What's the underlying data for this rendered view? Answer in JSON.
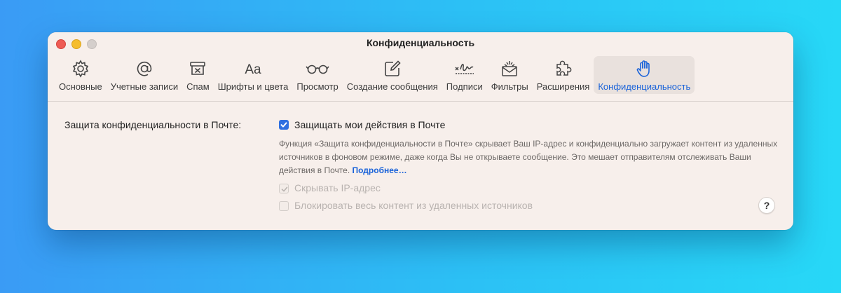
{
  "window": {
    "title": "Конфиденциальность"
  },
  "toolbar": {
    "items": [
      {
        "label": "Основные",
        "icon": "gear-icon"
      },
      {
        "label": "Учетные записи",
        "icon": "at-sign-icon"
      },
      {
        "label": "Спам",
        "icon": "junk-box-icon"
      },
      {
        "label": "Шрифты и цвета",
        "icon": "fonts-aa-icon"
      },
      {
        "label": "Просмотр",
        "icon": "glasses-icon"
      },
      {
        "label": "Создание сообщения",
        "icon": "compose-icon"
      },
      {
        "label": "Подписи",
        "icon": "signature-icon"
      },
      {
        "label": "Фильтры",
        "icon": "filter-envelope-icon"
      },
      {
        "label": "Расширения",
        "icon": "puzzle-icon"
      },
      {
        "label": "Конфиденциальность",
        "icon": "hand-icon",
        "active": true
      }
    ],
    "fonts_glyph": "Aa"
  },
  "privacy": {
    "row_label": "Защита конфиденциальности в Почте:",
    "protect_label": "Защищать мои действия в Почте",
    "protect_checked": true,
    "description": "Функция «Защита конфиденциальности в Почте» скрывает Ваш IP-адрес и конфиденциально загружает контент из удаленных источников в фоновом режиме, даже когда Вы не открываете сообщение. Это мешает отправителям отслеживать Ваши действия в Почте.",
    "learn_more": "Подробнее…",
    "hide_ip_label": "Скрывать IP-адрес",
    "hide_ip_checked": true,
    "block_content_label": "Блокировать весь контент из удаленных источников",
    "block_content_checked": false,
    "help": "?"
  },
  "colors": {
    "accent": "#2f6fe0",
    "link": "#1a63d9",
    "window_bg": "#f7efeb"
  }
}
